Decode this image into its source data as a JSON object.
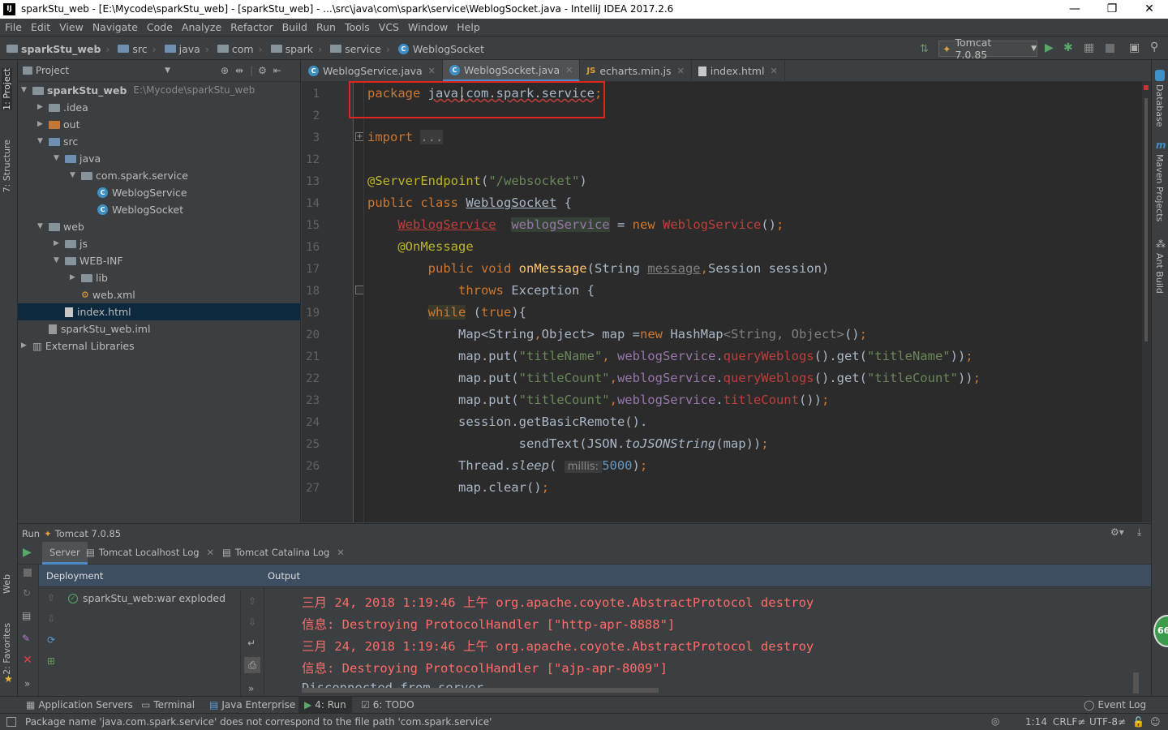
{
  "window": {
    "title": "sparkStu_web - [E:\\Mycode\\sparkStu_web] - [sparkStu_web] - ...\\src\\java\\com\\spark\\service\\WeblogSocket.java - IntelliJ IDEA 2017.2.6",
    "minimize": "—",
    "maximize": "❐",
    "close": "✕"
  },
  "menu": [
    "File",
    "Edit",
    "View",
    "Navigate",
    "Code",
    "Analyze",
    "Refactor",
    "Build",
    "Run",
    "Tools",
    "VCS",
    "Window",
    "Help"
  ],
  "breadcrumbs": [
    "sparkStu_web",
    "src",
    "java",
    "com",
    "spark",
    "service",
    "WeblogSocket"
  ],
  "run_config": "Tomcat 7.0.85",
  "project_panel": {
    "title": "Project",
    "tree": [
      {
        "label": "sparkStu_web",
        "extra": "E:\\Mycode\\sparkStu_web",
        "depth": 0,
        "expanded": true,
        "icon": "module-folder"
      },
      {
        "label": ".idea",
        "depth": 1,
        "expanded": false,
        "icon": "folder"
      },
      {
        "label": "out",
        "depth": 1,
        "expanded": false,
        "icon": "folder-orange"
      },
      {
        "label": "src",
        "depth": 1,
        "expanded": true,
        "icon": "folder-blue"
      },
      {
        "label": "java",
        "depth": 2,
        "expanded": true,
        "icon": "folder-blue"
      },
      {
        "label": "com.spark.service",
        "depth": 3,
        "expanded": true,
        "icon": "package"
      },
      {
        "label": "WeblogService",
        "depth": 4,
        "icon": "class"
      },
      {
        "label": "WeblogSocket",
        "depth": 4,
        "icon": "class"
      },
      {
        "label": "web",
        "depth": 1,
        "expanded": true,
        "icon": "folder"
      },
      {
        "label": "js",
        "depth": 2,
        "expanded": false,
        "icon": "folder"
      },
      {
        "label": "WEB-INF",
        "depth": 2,
        "expanded": true,
        "icon": "folder"
      },
      {
        "label": "lib",
        "depth": 3,
        "expanded": false,
        "icon": "folder"
      },
      {
        "label": "web.xml",
        "depth": 3,
        "icon": "xml"
      },
      {
        "label": "index.html",
        "depth": 2,
        "icon": "html",
        "selected": true
      },
      {
        "label": "sparkStu_web.iml",
        "depth": 1,
        "icon": "iml"
      },
      {
        "label": "External Libraries",
        "depth": 0,
        "expanded": false,
        "icon": "libraries"
      }
    ]
  },
  "editor_tabs": [
    {
      "label": "WeblogService.java",
      "active": false
    },
    {
      "label": "WeblogSocket.java",
      "active": true
    },
    {
      "label": "echarts.min.js",
      "active": false
    },
    {
      "label": "index.html",
      "active": false
    }
  ],
  "line_numbers": [
    "1",
    "2",
    "3",
    "12",
    "13",
    "14",
    "15",
    "16",
    "17",
    "18",
    "19",
    "20",
    "21",
    "22",
    "23",
    "24",
    "25",
    "26",
    "27"
  ],
  "side_tabs_left": [
    "1: Project",
    "7: Structure",
    "Web",
    "2: Favorites"
  ],
  "side_tabs_right": [
    "Database",
    "Maven Projects",
    "Ant Build"
  ],
  "run_panel": {
    "header_label": "Run",
    "header_config": "Tomcat 7.0.85",
    "tabs": [
      "Server",
      "Tomcat Localhost Log",
      "Tomcat Catalina Log"
    ],
    "deployment_header": "Deployment",
    "output_header": "Output",
    "deployment_item": "sparkStu_web:war exploded",
    "output_lines": [
      "三月 24, 2018 1:19:46 上午 org.apache.coyote.AbstractProtocol destroy",
      "信息: Destroying ProtocolHandler [\"http-apr-8888\"]",
      "三月 24, 2018 1:19:46 上午 org.apache.coyote.AbstractProtocol destroy",
      "信息: Destroying ProtocolHandler [\"ajp-apr-8009\"]",
      "Disconnected from server"
    ]
  },
  "bottom_tools": [
    "Application Servers",
    "Terminal",
    "Java Enterprise",
    "4: Run",
    "6: TODO",
    "Event Log"
  ],
  "status": {
    "message": "Package name 'java.com.spark.service' does not correspond to the file path 'com.spark.service'",
    "position": "1:14",
    "line_sep": "CRLF≠",
    "encoding": "UTF-8≠",
    "badge": "66"
  },
  "colors": {
    "accent": "#4a88c7",
    "editor_bg": "#2b2b2b",
    "panel_bg": "#3c3f41",
    "highlight_box": "#e0251f",
    "error_text": "#ff6b68"
  }
}
